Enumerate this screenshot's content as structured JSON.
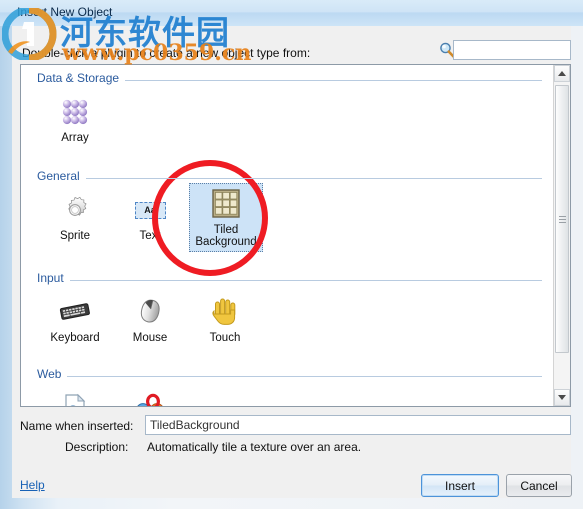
{
  "window": {
    "title": "Insert New Object"
  },
  "dialog": {
    "prompt": "Double-click a plugin to create a new object type from:",
    "search": {
      "value": "",
      "placeholder": "",
      "icon": "search-icon"
    }
  },
  "groups": [
    {
      "title": "Data & Storage",
      "items": [
        {
          "label": "Array",
          "icon": "array-icon",
          "selected": false
        }
      ]
    },
    {
      "title": "General",
      "items": [
        {
          "label": "Sprite",
          "icon": "gear-icon",
          "selected": false
        },
        {
          "label": "Text",
          "icon": "text-aa-icon",
          "selected": false
        },
        {
          "label": "Tiled Background",
          "icon": "tiled-background-icon",
          "selected": true
        }
      ]
    },
    {
      "title": "Input",
      "items": [
        {
          "label": "Keyboard",
          "icon": "keyboard-icon",
          "selected": false
        },
        {
          "label": "Mouse",
          "icon": "mouse-icon",
          "selected": false
        },
        {
          "label": "Touch",
          "icon": "hand-icon",
          "selected": false
        }
      ]
    },
    {
      "title": "Web",
      "items": [
        {
          "label": "",
          "icon": "html-page-icon",
          "selected": false
        },
        {
          "label": "",
          "icon": "browser-icon",
          "selected": false
        }
      ]
    }
  ],
  "fields": {
    "name_label": "Name when inserted:",
    "name_value": "TiledBackground",
    "description_label": "Description:",
    "description_value": "Automatically tile a texture over an area."
  },
  "footer": {
    "help_label": "Help",
    "insert_label": "Insert",
    "cancel_label": "Cancel"
  },
  "watermark": {
    "site_cn": "河东软件园",
    "site_url": "www.pc0359.cn"
  },
  "colors": {
    "group_title": "#2b5b9e",
    "selection": "#cde3f7",
    "link": "#1861b5",
    "annotation_circle": "#ef1c23",
    "watermark_blue": "#1f7fd0",
    "watermark_orange": "#e8821a"
  }
}
